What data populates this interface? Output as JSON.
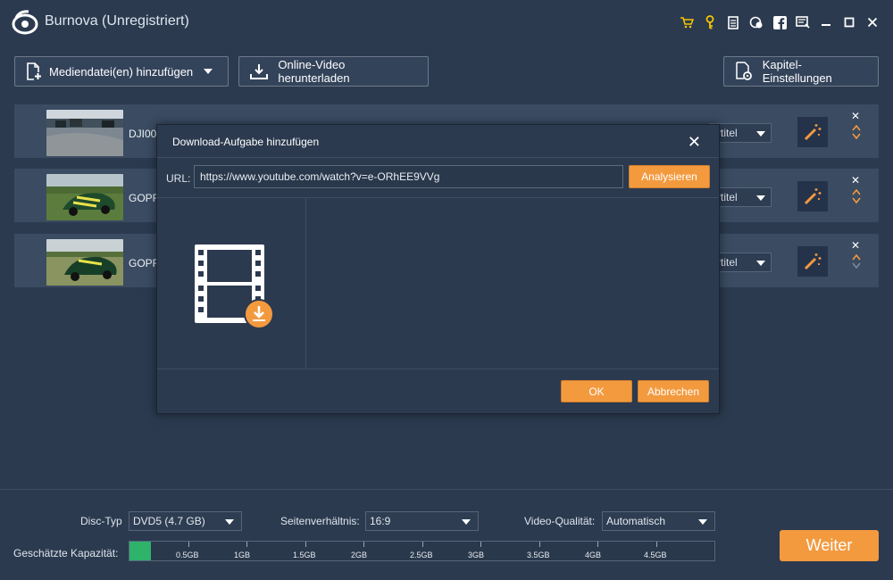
{
  "app": {
    "title": "Burnova (Unregistriert)"
  },
  "titlebar": {
    "icons": [
      "cart-icon",
      "key-icon",
      "document-icon",
      "chat-icon",
      "facebook-icon",
      "feedback-icon",
      "minimize-icon",
      "maximize-icon",
      "close-icon"
    ]
  },
  "toolbar": {
    "add_media_label": "Mediendatei(en) hinzufügen",
    "download_online_label": "Online-Video herunterladen",
    "chapter_settings_label": "Kapitel-Einstellungen"
  },
  "media_rows": [
    {
      "name": "DJI00",
      "subtitle": "rtitel"
    },
    {
      "name": "GOPR",
      "subtitle": "rtitel"
    },
    {
      "name": "GOPR",
      "subtitle": "rtitel"
    }
  ],
  "dialog": {
    "title": "Download-Aufgabe hinzufügen",
    "url_label": "URL:",
    "url_value": "https://www.youtube.com/watch?v=e-ORhEE9VVg",
    "analyze_label": "Analysieren",
    "ok_label": "OK",
    "cancel_label": "Abbrechen"
  },
  "bottom": {
    "disc_type_label": "Disc-Typ",
    "disc_type_value": "DVD5 (4.7 GB)",
    "aspect_label": "Seitenverhältnis:",
    "aspect_value": "16:9",
    "quality_label": "Video-Qualität:",
    "quality_value": "Automatisch",
    "capacity_label": "Geschätzte Kapazität:",
    "capacity_ticks": [
      "0.5GB",
      "1GB",
      "1.5GB",
      "2GB",
      "2.5GB",
      "3GB",
      "3.5GB",
      "4GB",
      "4.5GB"
    ],
    "capacity_fraction": 0.037,
    "next_label": "Weiter"
  },
  "colors": {
    "accent": "#f39a3f",
    "background": "#2b3a4f",
    "capacity_fill": "#2fb26a"
  }
}
